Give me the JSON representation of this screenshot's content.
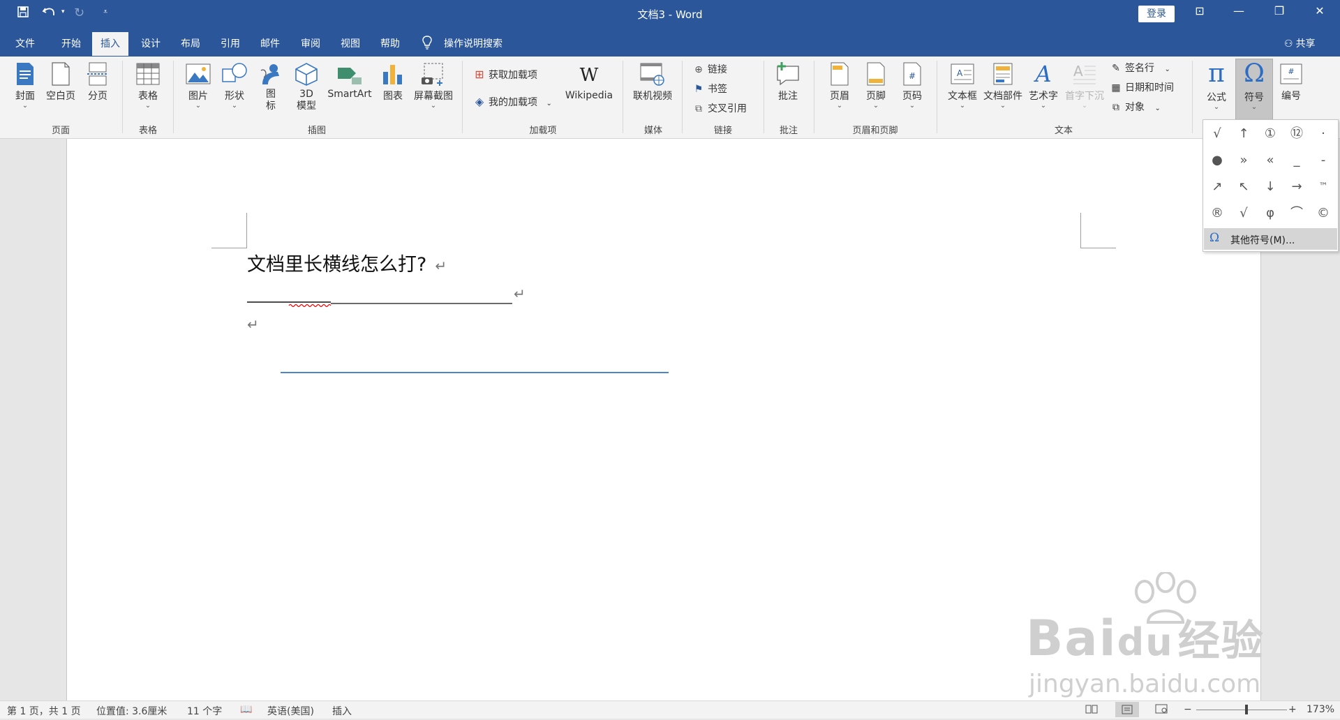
{
  "titlebar": {
    "document_title": "文档3  -  Word",
    "login_label": "登录",
    "minimize": "—",
    "restore": "❐",
    "close": "✕",
    "ribbon_display": "⊡"
  },
  "tabs": [
    "文件",
    "开始",
    "插入",
    "设计",
    "布局",
    "引用",
    "邮件",
    "审阅",
    "视图",
    "帮助"
  ],
  "active_tab": "插入",
  "search_label": "操作说明搜索",
  "share_label": "共享",
  "ribbon": {
    "groups": {
      "pages": "页面",
      "tables": "表格",
      "illustrations": "插图",
      "addins": "加载项",
      "media": "媒体",
      "links": "链接",
      "comments": "批注",
      "header_footer": "页眉和页脚",
      "text": "文本"
    },
    "buttons": {
      "cover": "封面",
      "blank_page": "空白页",
      "page_break": "分页",
      "table": "表格",
      "picture": "图片",
      "shapes": "形状",
      "icons_1": "图",
      "icons_2": "标",
      "model3d_1": "3D",
      "model3d_2": "模型",
      "smartart": "SmartArt",
      "chart": "图表",
      "screenshot": "屏幕截图",
      "get_addins": "获取加载项",
      "my_addins": "我的加载项",
      "wikipedia": "Wikipedia",
      "online_video": "联机视频",
      "link": "链接",
      "bookmark": "书签",
      "cross_ref": "交叉引用",
      "comment": "批注",
      "header": "页眉",
      "footer": "页脚",
      "page_number": "页码",
      "textbox": "文本框",
      "quick_parts": "文档部件",
      "wordart": "艺术字",
      "dropcap": "首字下沉",
      "signature": "签名行",
      "datetime": "日期和时间",
      "object": "对象",
      "equation": "公式",
      "symbol": "符号",
      "numbering": "编号"
    }
  },
  "document": {
    "line1": "文档里长横线怎么打?",
    "paragraph_mark": "↵"
  },
  "symbol_panel": {
    "symbols": [
      "√",
      "↑",
      "①",
      "⑫",
      "·",
      "●",
      "»",
      "«",
      "_",
      "-",
      "↗",
      "↖",
      "↓",
      "→",
      "™",
      "®",
      "√",
      "φ",
      "⌒",
      "©"
    ],
    "more_label": "其他符号(M)...",
    "more_icon": "Ω"
  },
  "statusbar": {
    "page": "第 1 页，共 1 页",
    "position": "位置值: 3.6厘米",
    "words": "11 个字",
    "language": "英语(美国)",
    "mode": "插入",
    "zoom_minus": "−",
    "zoom_plus": "+",
    "zoom": "173%"
  },
  "watermark": {
    "brand": "Bai",
    "brand2": "du",
    "cn": "经验",
    "url": "jingyan.baidu.com"
  },
  "colors": {
    "accent": "#2b579a",
    "ribbon_bg": "#f3f3f3",
    "page_bg": "#ffffff",
    "spell_error": "#e00000",
    "drawn_line": "#4a86c8"
  }
}
